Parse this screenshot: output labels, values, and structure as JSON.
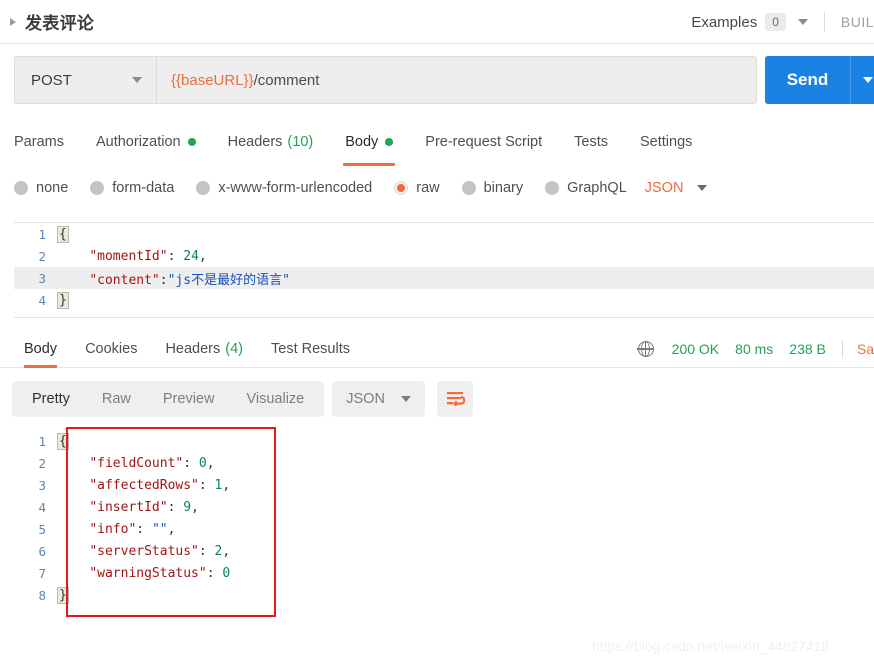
{
  "titlebar": {
    "request_name": "发表评论",
    "collapse_icon": "triangle-right-icon",
    "examples_label": "Examples",
    "examples_count": "0",
    "build_label": "BUIL"
  },
  "urlbar": {
    "method": "POST",
    "url_variable": "{{baseURL}}",
    "url_path": "/comment",
    "send_label": "Send",
    "send_color": "#1a82e2"
  },
  "request_tabs": [
    {
      "label": "Params",
      "badge": "",
      "dot": false,
      "active": false
    },
    {
      "label": "Authorization",
      "badge": "",
      "dot": true,
      "active": false
    },
    {
      "label": "Headers",
      "badge": "(10)",
      "dot": false,
      "active": false
    },
    {
      "label": "Body",
      "badge": "",
      "dot": true,
      "active": true
    },
    {
      "label": "Pre-request Script",
      "badge": "",
      "dot": false,
      "active": false
    },
    {
      "label": "Tests",
      "badge": "",
      "dot": false,
      "active": false
    },
    {
      "label": "Settings",
      "badge": "",
      "dot": false,
      "active": false
    }
  ],
  "body_types": [
    {
      "label": "none",
      "selected": false
    },
    {
      "label": "form-data",
      "selected": false
    },
    {
      "label": "x-www-form-urlencoded",
      "selected": false
    },
    {
      "label": "raw",
      "selected": true
    },
    {
      "label": "binary",
      "selected": false
    },
    {
      "label": "GraphQL",
      "selected": false
    }
  ],
  "body_format": "JSON",
  "request_body": {
    "lines": [
      {
        "num": "1",
        "highlighted": false
      },
      {
        "num": "2",
        "highlighted": false
      },
      {
        "num": "3",
        "highlighted": true
      },
      {
        "num": "4",
        "highlighted": false
      }
    ],
    "l1_open": "{",
    "l2_key": "\"momentId\"",
    "l2_colon": ": ",
    "l2_val": "24",
    "l2_comma": ",",
    "l3_key": "\"content\"",
    "l3_colon": ":",
    "l3_val": "\"js不是最好的语言\"",
    "l4_close": "}"
  },
  "response_tabs": [
    {
      "label": "Body",
      "badge": "",
      "active": true
    },
    {
      "label": "Cookies",
      "badge": "",
      "active": false
    },
    {
      "label": "Headers",
      "badge": "(4)",
      "active": false
    },
    {
      "label": "Test Results",
      "badge": "",
      "active": false
    }
  ],
  "response_status": {
    "globe_icon": "globe-icon",
    "status": "200 OK",
    "time": "80 ms",
    "size": "238 B",
    "save_response": "Sa",
    "status_color": "#21a453"
  },
  "view_toolbar": {
    "segments": [
      {
        "label": "Pretty",
        "active": true
      },
      {
        "label": "Raw",
        "active": false
      },
      {
        "label": "Preview",
        "active": false
      },
      {
        "label": "Visualize",
        "active": false
      }
    ],
    "format": "JSON",
    "wrap_icon": "word-wrap-icon",
    "wrap_color": "#ef6c3e"
  },
  "response_body": {
    "lines": [
      "1",
      "2",
      "3",
      "4",
      "5",
      "6",
      "7",
      "8"
    ],
    "open_brace": "{",
    "close_brace": "}",
    "entries": [
      {
        "key": "\"fieldCount\"",
        "value": "0",
        "comma": ","
      },
      {
        "key": "\"affectedRows\"",
        "value": "1",
        "comma": ","
      },
      {
        "key": "\"insertId\"",
        "value": "9",
        "comma": ","
      },
      {
        "key": "\"info\"",
        "value": "\"\"",
        "comma": ","
      },
      {
        "key": "\"serverStatus\"",
        "value": "2",
        "comma": ","
      },
      {
        "key": "\"warningStatus\"",
        "value": "0",
        "comma": ""
      }
    ]
  },
  "watermark": "https://blog.csdn.net/weixin_44827418"
}
